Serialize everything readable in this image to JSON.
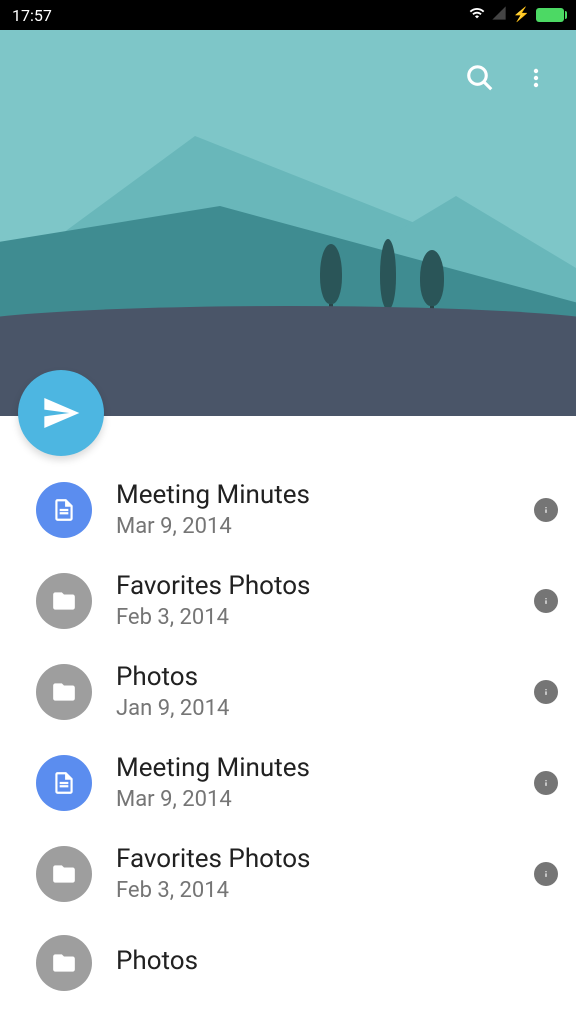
{
  "status": {
    "time": "17:57"
  },
  "colors": {
    "accent": "#4db6e1",
    "avatar_blue": "#5b8def",
    "avatar_grey": "#9e9e9e"
  },
  "icons": {
    "doc": "document-icon",
    "folder": "folder-icon"
  },
  "items": [
    {
      "title": "Meeting Minutes",
      "date": "Mar 9, 2014",
      "type": "doc"
    },
    {
      "title": "Favorites Photos",
      "date": "Feb 3, 2014",
      "type": "folder"
    },
    {
      "title": "Photos",
      "date": "Jan 9, 2014",
      "type": "folder"
    },
    {
      "title": "Meeting Minutes",
      "date": "Mar 9, 2014",
      "type": "doc"
    },
    {
      "title": "Favorites Photos",
      "date": "Feb 3, 2014",
      "type": "folder"
    },
    {
      "title": "Photos",
      "date": "",
      "type": "folder"
    }
  ]
}
